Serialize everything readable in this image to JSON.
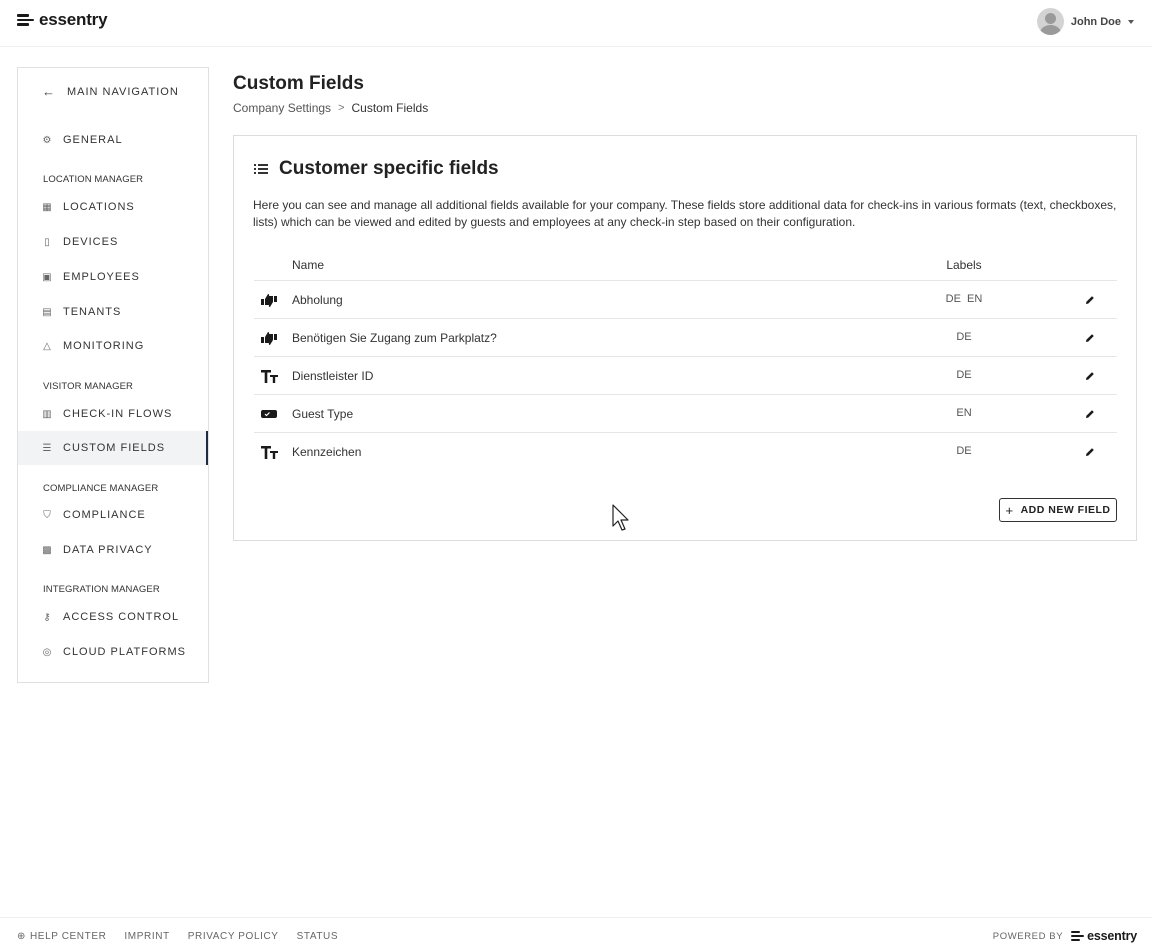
{
  "header": {
    "logo_text": "essentry",
    "user_name": "John Doe"
  },
  "sidebar": {
    "back_label": "MAIN NAVIGATION",
    "general": "GENERAL",
    "sections": {
      "location": "LOCATION MANAGER",
      "visitor": "VISITOR MANAGER",
      "compliance": "COMPLIANCE MANAGER",
      "integration": "INTEGRATION MANAGER"
    },
    "items": {
      "locations": "LOCATIONS",
      "devices": "DEVICES",
      "employees": "EMPLOYEES",
      "tenants": "TENANTS",
      "monitoring": "MONITORING",
      "checkin_flows": "CHECK-IN FLOWS",
      "custom_fields": "CUSTOM FIELDS",
      "compliance": "COMPLIANCE",
      "data_privacy": "DATA PRIVACY",
      "access_control": "ACCESS CONTROL",
      "cloud_platforms": "CLOUD PLATFORMS"
    },
    "active": "custom_fields"
  },
  "main": {
    "title": "Custom Fields",
    "breadcrumb": {
      "parent": "Company Settings",
      "separator": ">",
      "current": "Custom Fields"
    },
    "card": {
      "title": "Customer specific fields",
      "description": "Here you can see and manage all additional fields available for your company. These fields store additional data for check-ins in various formats (text, checkboxes, lists) which can be viewed and edited by guests and employees at any check-in step based on their configuration.",
      "columns": {
        "name": "Name",
        "labels": "Labels"
      },
      "rows": [
        {
          "icon": "thumbs-icon",
          "name": "Abholung",
          "labels": "DE  EN"
        },
        {
          "icon": "thumbs-icon",
          "name": "Benötigen Sie Zugang zum Parkplatz?",
          "labels": "DE"
        },
        {
          "icon": "text-type-icon",
          "name": "Dienstleister ID",
          "labels": "DE"
        },
        {
          "icon": "checkbox-type-icon",
          "name": "Guest Type",
          "labels": "EN"
        },
        {
          "icon": "text-type-icon",
          "name": "Kennzeichen",
          "labels": "DE"
        }
      ],
      "add_button": "ADD NEW FIELD"
    }
  },
  "footer": {
    "links": {
      "help": "HELP CENTER",
      "imprint": "IMPRINT",
      "privacy": "PRIVACY POLICY",
      "status": "STATUS"
    },
    "powered_by": "POWERED BY",
    "logo_text": "essentry"
  },
  "colors": {
    "active_indicator": "#1f2a44",
    "border": "#e0e0e0",
    "text": "#222222"
  }
}
